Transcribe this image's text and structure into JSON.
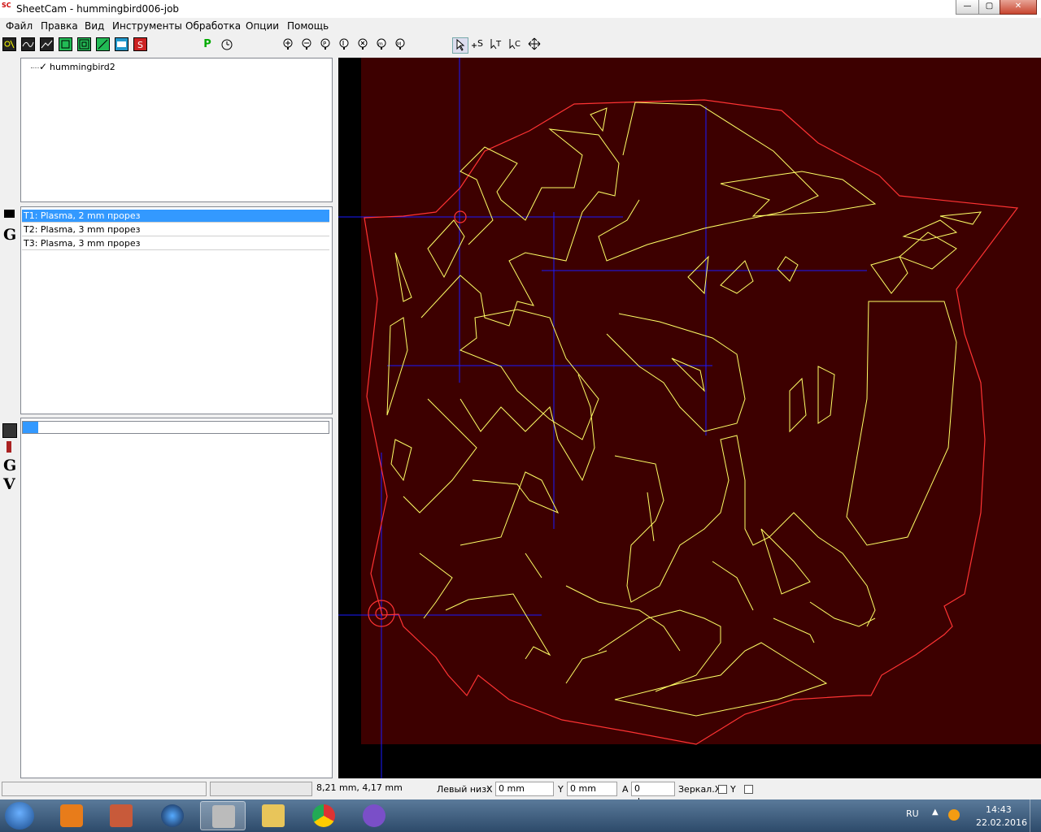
{
  "window": {
    "app_icon": "SC",
    "title": "SheetCam - hummingbird006-job",
    "minimize": "—",
    "maximize": "▢",
    "close": "✕"
  },
  "menu": [
    "Файл",
    "Правка",
    "Вид",
    "Инструменты",
    "Обработка",
    "Опции",
    "Помощь"
  ],
  "toolbar": {
    "post_label": "P",
    "icons": [
      "shape-icon",
      "line-icon",
      "path-icon",
      "contour-icon",
      "offset-icon",
      "diagonal-icon",
      "plate-icon",
      "start-icon",
      "timer-icon",
      "zoom-in-icon",
      "zoom-out-icon",
      "zoom-prev-icon",
      "zoom-fit-icon",
      "zoom-all-icon",
      "zoom-extent-icon",
      "zoom-window-icon",
      "select-icon",
      "start-point-icon",
      "text-cursor-icon",
      "rotate-icon",
      "move-icon"
    ]
  },
  "layers": {
    "items": [
      {
        "label": "hummingbird2",
        "checked": true
      }
    ]
  },
  "operations": {
    "glyph": "G",
    "items": [
      {
        "label": "T1: Plasma, 2 mm прорез",
        "selected": true
      },
      {
        "label": "T2: Plasma, 3 mm прорез",
        "selected": false
      },
      {
        "label": "T3: Plasma, 3 mm прорез",
        "selected": false
      }
    ]
  },
  "tools": {
    "glyphs": [
      "G",
      "V"
    ],
    "progress": 0.05
  },
  "canvas": {
    "background": "#3d0000",
    "outer": "#000000",
    "part_color": "#ffff66",
    "outline_color": "#ff3333",
    "axis_color": "#1a1aff"
  },
  "status": {
    "coords": "8,21 mm, 4,17 mm",
    "origin_label": "Левый низ:",
    "x_label": "X",
    "x_value": "0 mm",
    "y_label": "Y",
    "y_value": "0 mm",
    "a_label": "A",
    "angle_value": "0 degrees",
    "mirror_label": "Зеркал.X",
    "mirror_y_label": "Y"
  },
  "taskbar": {
    "apps": [
      "start-orb",
      "media-player",
      "archive",
      "google-earth",
      "sheetcam",
      "file-explorer",
      "chrome",
      "viber"
    ],
    "lang": "RU",
    "time": "14:43",
    "date": "22.02.2016"
  }
}
